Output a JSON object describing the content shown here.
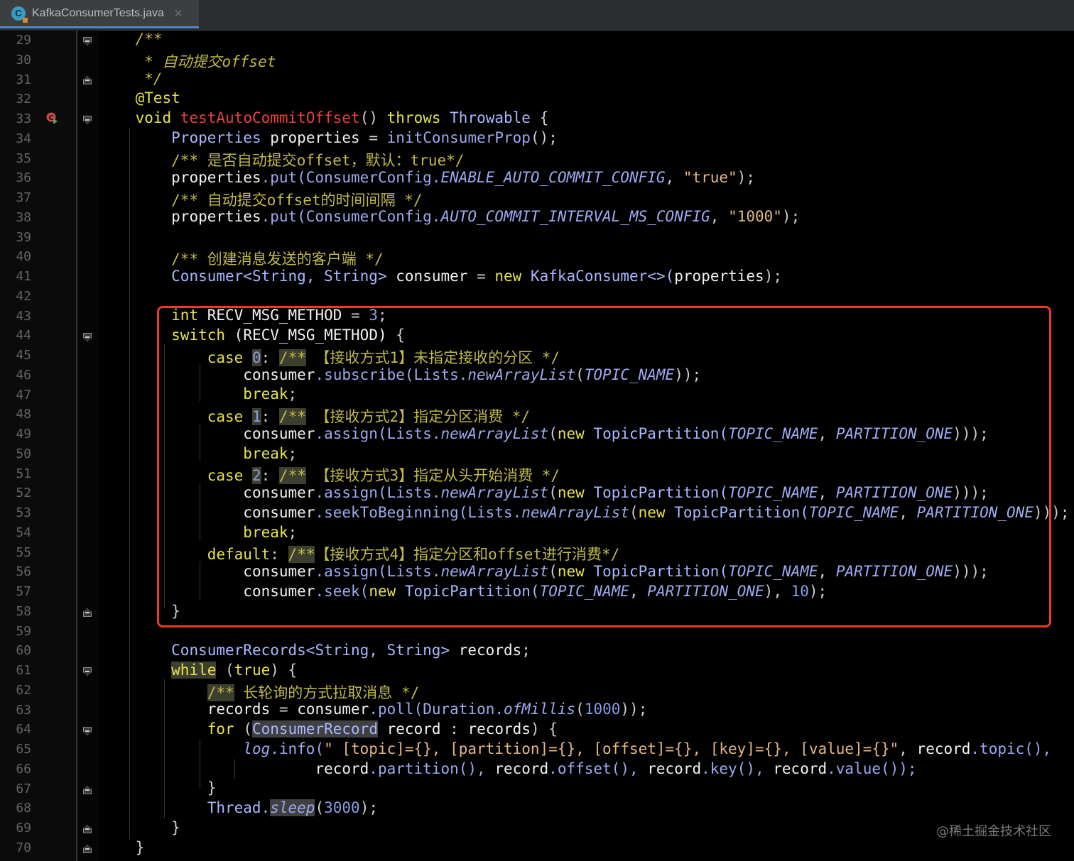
{
  "tab": {
    "filename": "KafkaConsumerTests.java",
    "icon_letter": "C",
    "close_glyph": "✕"
  },
  "line_numbers": [
    "29",
    "30",
    "31",
    "32",
    "33",
    "34",
    "35",
    "36",
    "37",
    "38",
    "39",
    "40",
    "41",
    "42",
    "43",
    "44",
    "45",
    "46",
    "47",
    "48",
    "49",
    "50",
    "51",
    "52",
    "53",
    "54",
    "55",
    "56",
    "57",
    "58",
    "59",
    "60",
    "61",
    "62",
    "63",
    "64",
    "65",
    "66",
    "67",
    "68",
    "69",
    "70"
  ],
  "code": {
    "l29": {
      "a": "/**"
    },
    "l30": {
      "a": " * 自动提交offset"
    },
    "l31": {
      "a": " */"
    },
    "l32": {
      "a": "@Test"
    },
    "l33": {
      "kw": "void",
      "fn": "testAutoCommitOffset",
      "p1": "()",
      "kw2": "throws",
      "ty": "Throwable",
      "p2": "{"
    },
    "l34": {
      "ty": "Properties",
      "id": "properties",
      "op": "=",
      "fn": "initConsumerProp",
      "p": "();"
    },
    "l35": {
      "cm": "/** 是否自动提交offset，默认：true*/"
    },
    "l36": {
      "id": "properties",
      "fn": ".put(ConsumerConfig.",
      "cst": "ENABLE_AUTO_COMMIT_CONFIG",
      "sep": ", ",
      "st": "\"true\"",
      "end": ");"
    },
    "l37": {
      "cm": "/** 自动提交offset的时间间隔 */"
    },
    "l38": {
      "id": "properties",
      "fn": ".put(ConsumerConfig.",
      "cst": "AUTO_COMMIT_INTERVAL_MS_CONFIG",
      "sep": ", ",
      "st": "\"1000\"",
      "end": ");"
    },
    "l40": {
      "cm": "/** 创建消息发送的客户端 */"
    },
    "l41": {
      "ty": "Consumer<String, String>",
      "id": "consumer",
      "op": "=",
      "kw": "new",
      "ty2": "KafkaConsumer<>(",
      "id2": "properties",
      "end": ");"
    },
    "l43": {
      "kw": "int",
      "id": "RECV_MSG_METHOD",
      "op": "=",
      "num": "3",
      "end": ";"
    },
    "l44": {
      "kw": "switch",
      "id": "(RECV_MSG_METHOD)",
      "end": "{"
    },
    "l45": {
      "kw": "case",
      "num": "0",
      "colon": ":",
      "cm": "/**",
      "cmt": " 【接收方式1】未指定接收的分区 */"
    },
    "l46": {
      "id": "consumer",
      "fn": ".subscribe(Lists.",
      "it": "newArrayList",
      "p": "(",
      "cst": "TOPIC_NAME",
      "end": "));"
    },
    "l47": {
      "kw": "break",
      "end": ";"
    },
    "l48": {
      "kw": "case",
      "num": "1",
      "colon": ":",
      "cm": "/**",
      "cmt": " 【接收方式2】指定分区消费 */"
    },
    "l49": {
      "id": "consumer",
      "fn": ".assign(Lists.",
      "it": "newArrayList",
      "p": "(",
      "kw": "new",
      "ty": "TopicPartition(",
      "cst": "TOPIC_NAME",
      "sep": ", ",
      "cst2": "PARTITION_ONE",
      "end": ")));"
    },
    "l50": {
      "kw": "break",
      "end": ";"
    },
    "l51": {
      "kw": "case",
      "num": "2",
      "colon": ":",
      "cm": "/**",
      "cmt": " 【接收方式3】指定从头开始消费 */"
    },
    "l52": {
      "id": "consumer",
      "fn": ".assign(Lists.",
      "it": "newArrayList",
      "p": "(",
      "kw": "new",
      "ty": "TopicPartition(",
      "cst": "TOPIC_NAME",
      "sep": ", ",
      "cst2": "PARTITION_ONE",
      "end": ")));"
    },
    "l53": {
      "id": "consumer",
      "fn": ".seekToBeginning(Lists.",
      "it": "newArrayList",
      "p": "(",
      "kw": "new",
      "ty": "TopicPartition(",
      "cst": "TOPIC_NAME",
      "sep": ", ",
      "cst2": "PARTITION_ONE",
      "end": ")));"
    },
    "l54": {
      "kw": "break",
      "end": ";"
    },
    "l55": {
      "kw": "default",
      "colon": ":",
      "cm": "/**",
      "cmt": "【接收方式4】指定分区和offset进行消费*/"
    },
    "l56": {
      "id": "consumer",
      "fn": ".assign(Lists.",
      "it": "newArrayList",
      "p": "(",
      "kw": "new",
      "ty": "TopicPartition(",
      "cst": "TOPIC_NAME",
      "sep": ", ",
      "cst2": "PARTITION_ONE",
      "end": ")));"
    },
    "l57": {
      "id": "consumer",
      "fn": ".seek(",
      "kw": "new",
      "ty": "TopicPartition(",
      "cst": "TOPIC_NAME",
      "sep": ", ",
      "cst2": "PARTITION_ONE",
      "p2": "), ",
      "num": "10",
      "end": ");"
    },
    "l58": {
      "p": "}"
    },
    "l60": {
      "ty": "ConsumerRecords<String, String>",
      "id": "records",
      "end": ";"
    },
    "l61": {
      "kw": "while",
      "p": "(",
      "kw2": "true",
      "p2": ") {"
    },
    "l62": {
      "cm": "/**",
      "cmt": " 长轮询的方式拉取消息 */"
    },
    "l63": {
      "id": "records",
      "op": "=",
      "id2": "consumer",
      "fn": ".poll(Duration.",
      "it": "ofMillis",
      "p": "(",
      "num": "1000",
      "end": "));"
    },
    "l64": {
      "kw": "for",
      "p": "(",
      "ty": "ConsumerRecord",
      "id": "record",
      "op": ":",
      "id2": "records",
      "end": ") {"
    },
    "l65": {
      "it": "log",
      "fn": ".info(",
      "st": "\" [topic]={}, [partition]={}, [offset]={}, [key]={}, [value]={}\"",
      "sep": ", ",
      "id": "record",
      "fn2": ".topic(),"
    },
    "l66": {
      "id": "record",
      "fn": ".partition(), ",
      "id2": "record",
      "fn2": ".offset(), ",
      "id3": "record",
      "fn3": ".key(), ",
      "id4": "record",
      "fn4": ".value());"
    },
    "l67": {
      "p": "}"
    },
    "l68": {
      "ty": "Thread.",
      "it": "sleep",
      "p": "(",
      "num": "3000",
      "end": ");"
    },
    "l69": {
      "p": "}"
    },
    "l70": {
      "p": "}"
    }
  },
  "watermark": "@稀土掘金技术社区",
  "colors": {
    "background": "#000000",
    "keyword": "#e8e24a",
    "comment": "#c0b94a",
    "method_decl": "#e8413c",
    "string": "#e3b783",
    "highlight_border": "#e83b2a"
  }
}
